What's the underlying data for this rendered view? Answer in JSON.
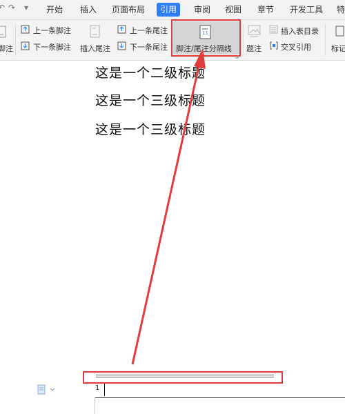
{
  "quick_access": {
    "undo_glyph": "↶",
    "redo_glyph": "↷",
    "more_glyph": "▾"
  },
  "menu": {
    "items": [
      "开始",
      "插入",
      "页面布局",
      "引用",
      "审阅",
      "视图",
      "章节",
      "开发工具",
      "特"
    ],
    "active_index": 3
  },
  "ribbon": {
    "insert_footnote_label": "脚注",
    "prev_footnote_label": "上一条脚注",
    "next_footnote_label": "下一条脚注",
    "insert_endnote_label": "插入尾注",
    "prev_endnote_label": "上一条尾注",
    "next_endnote_label": "下一条尾注",
    "separator_label": "脚注/尾注分隔线",
    "caption_label": "题注",
    "insert_table_of_figures_label": "插入表目录",
    "cross_reference_label": "交叉引用",
    "mark_label": "标记"
  },
  "document": {
    "headings": [
      "这是一个二级标题",
      "这是一个三级标题",
      "这是一个三级标题"
    ],
    "footnote_number": "1"
  },
  "colors": {
    "accent": "#2e7cf6",
    "highlight": "#e23b3b",
    "ribbon_bg": "#f3f3f3",
    "disabled_text": "#aaaaaa"
  }
}
